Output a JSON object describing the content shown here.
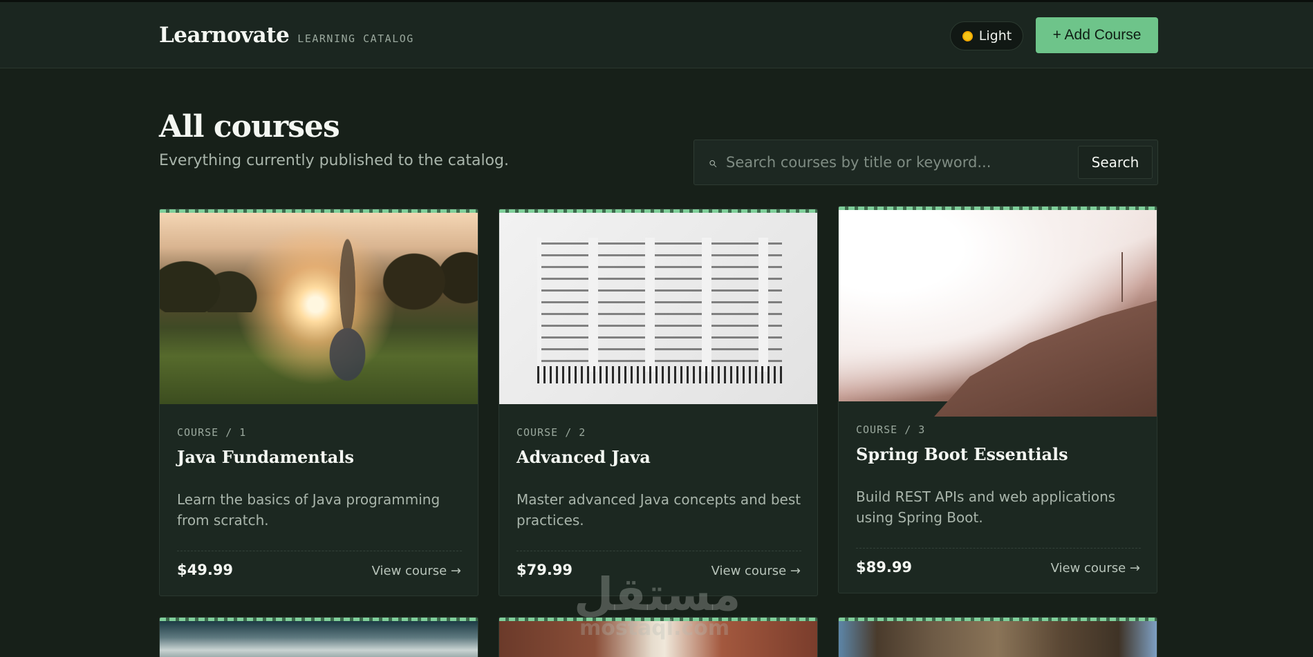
{
  "header": {
    "brand": "Learnovate",
    "tagline": "LEARNING CATALOG",
    "theme_label": "Light",
    "add_label": "+ Add Course"
  },
  "main": {
    "title": "All courses",
    "subtitle": "Everything currently published to the catalog.",
    "search": {
      "placeholder": "Search courses by title or keyword...",
      "value": "",
      "button": "Search"
    }
  },
  "courses": [
    {
      "meta": "COURSE / 1",
      "title": "Java Fundamentals",
      "description": "Learn the basics of Java programming from scratch.",
      "price": "$49.99",
      "link": "View course →"
    },
    {
      "meta": "COURSE / 2",
      "title": "Advanced Java",
      "description": "Master advanced Java concepts and best practices.",
      "price": "$79.99",
      "link": "View course →"
    },
    {
      "meta": "COURSE / 3",
      "title": "Spring Boot Essentials",
      "description": "Build REST APIs and web applications using Spring Boot.",
      "price": "$89.99",
      "link": "View course →"
    }
  ],
  "watermark": {
    "text": "مستقل",
    "url": "mostaql.com"
  },
  "colors": {
    "accent": "#6ec48a",
    "background": "#172019",
    "card": "#1c2821"
  }
}
